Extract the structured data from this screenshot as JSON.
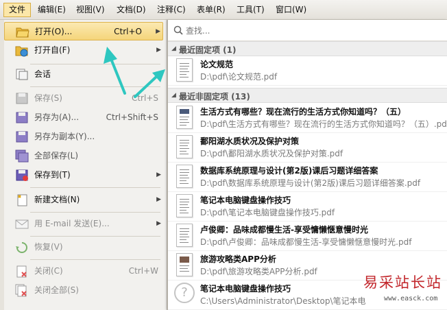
{
  "menubar": {
    "file": "文件",
    "edit": "编辑(E)",
    "view": "视图(V)",
    "document": "文档(D)",
    "comment": "注释(C)",
    "form": "表单(R)",
    "tools": "工具(T)",
    "window": "窗口(W)"
  },
  "file_menu": {
    "items": [
      {
        "label": "打开(O)...",
        "shortcut": "Ctrl+O",
        "icon": "open-folder-icon",
        "highlighted": true
      },
      {
        "label": "打开自(F)",
        "shortcut": "",
        "icon": "open-from-globe-icon"
      },
      {
        "label": "会话",
        "shortcut": "",
        "icon": "session-icon"
      },
      {
        "label": "保存(S)",
        "shortcut": "Ctrl+S",
        "icon": "save-icon",
        "disabled": true
      },
      {
        "label": "另存为(A)...",
        "shortcut": "Ctrl+Shift+S",
        "icon": "save-as-icon"
      },
      {
        "label": "另存为副本(Y)...",
        "shortcut": "",
        "icon": "save-copy-icon"
      },
      {
        "label": "全部保存(L)",
        "shortcut": "",
        "icon": "save-all-icon"
      },
      {
        "label": "保存到(T)",
        "shortcut": "",
        "icon": "save-to-icon"
      },
      {
        "label": "新建文档(N)",
        "shortcut": "",
        "icon": "new-document-icon"
      },
      {
        "label": "用 E-mail 发送(E)...",
        "shortcut": "",
        "icon": "email-icon",
        "disabled": true
      },
      {
        "label": "恢复(V)",
        "shortcut": "",
        "icon": "revert-icon",
        "disabled": true
      },
      {
        "label": "关闭(C)",
        "shortcut": "Ctrl+W",
        "icon": "close-doc-icon",
        "disabled": true
      },
      {
        "label": "关闭全部(S)",
        "shortcut": "",
        "icon": "close-all-icon",
        "disabled": true
      }
    ]
  },
  "recent_panel": {
    "search_placeholder": "查找...",
    "pinned_header": "最近固定项 (1)",
    "pinned": [
      {
        "name": "论文规范",
        "path": "D:\\pdf\\论文规范.pdf"
      }
    ],
    "unpinned_header": "最近非固定项 (13)",
    "unpinned": [
      {
        "name": "生活方式有哪些？现在流行的生活方式你知道吗？（五）",
        "path": "D:\\pdf\\生活方式有哪些？现在流行的生活方式你知道吗？（五）.pdf"
      },
      {
        "name": "鄱阳湖水质状况及保护对策",
        "path": "D:\\pdf\\鄱阳湖水质状况及保护对策.pdf"
      },
      {
        "name": "数据库系统原理与设计(第2版)课后习题详细答案",
        "path": "D:\\pdf\\数据库系统原理与设计(第2版)课后习题详细答案.pdf"
      },
      {
        "name": "笔记本电脑键盘操作技巧",
        "path": "D:\\pdf\\笔记本电脑键盘操作技巧.pdf"
      },
      {
        "name": "卢俊卿：品味成都慢生活-享受慵懒惬意慢时光",
        "path": "D:\\pdf\\卢俊卿：品味成都慢生活-享受慵懒惬意慢时光.pdf"
      },
      {
        "name": "旅游攻略类APP分析",
        "path": "D:\\pdf\\旅游攻略类APP分析.pdf"
      },
      {
        "name": "笔记本电脑键盘操作技巧",
        "path": "C:\\Users\\Administrator\\Desktop\\笔记本电"
      }
    ]
  },
  "watermark": {
    "title": "易采站长站",
    "url": "www.easck.com"
  },
  "colors": {
    "highlight": "#f5d57a",
    "arrow": "#2ec7c0",
    "watermark": "#c2262b"
  }
}
